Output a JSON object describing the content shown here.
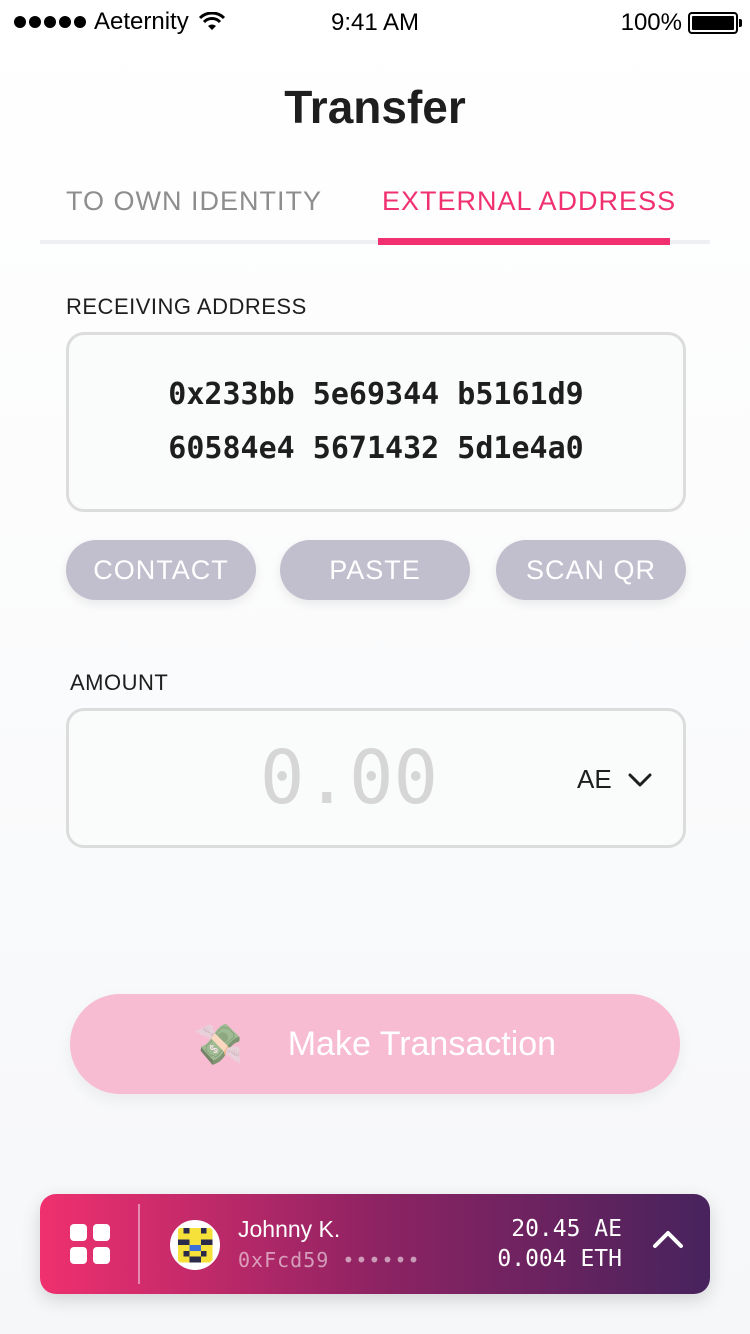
{
  "status_bar": {
    "carrier": "Aeternity",
    "time": "9:41 AM",
    "battery": "100%"
  },
  "title": "Transfer",
  "tabs": [
    {
      "label": "TO OWN IDENTITY",
      "active": false
    },
    {
      "label": "EXTERNAL ADDRESS",
      "active": true
    }
  ],
  "receiving": {
    "label": "RECEIVING ADDRESS",
    "line1": "0x233bb 5e69344 b5161d9",
    "line2": "60584e4 5671432 5d1e4a0"
  },
  "actions": {
    "contact": "CONTACT",
    "paste": "PASTE",
    "scan": "SCAN QR"
  },
  "amount": {
    "label": "AMOUNT",
    "placeholder": "0.00",
    "currency": "AE"
  },
  "make_transaction": {
    "label": "Make Transaction",
    "icon": "money-with-wings-icon"
  },
  "account": {
    "name": "Johnny K.",
    "address": "0xFcd59 ••••••",
    "balance_ae": "20.45 AE",
    "balance_eth": "0.004 ETH"
  },
  "colors": {
    "accent": "#f0306f",
    "pill": "#c1bece",
    "button_disabled": "#f7bbd2",
    "bar_end": "#47235d"
  }
}
